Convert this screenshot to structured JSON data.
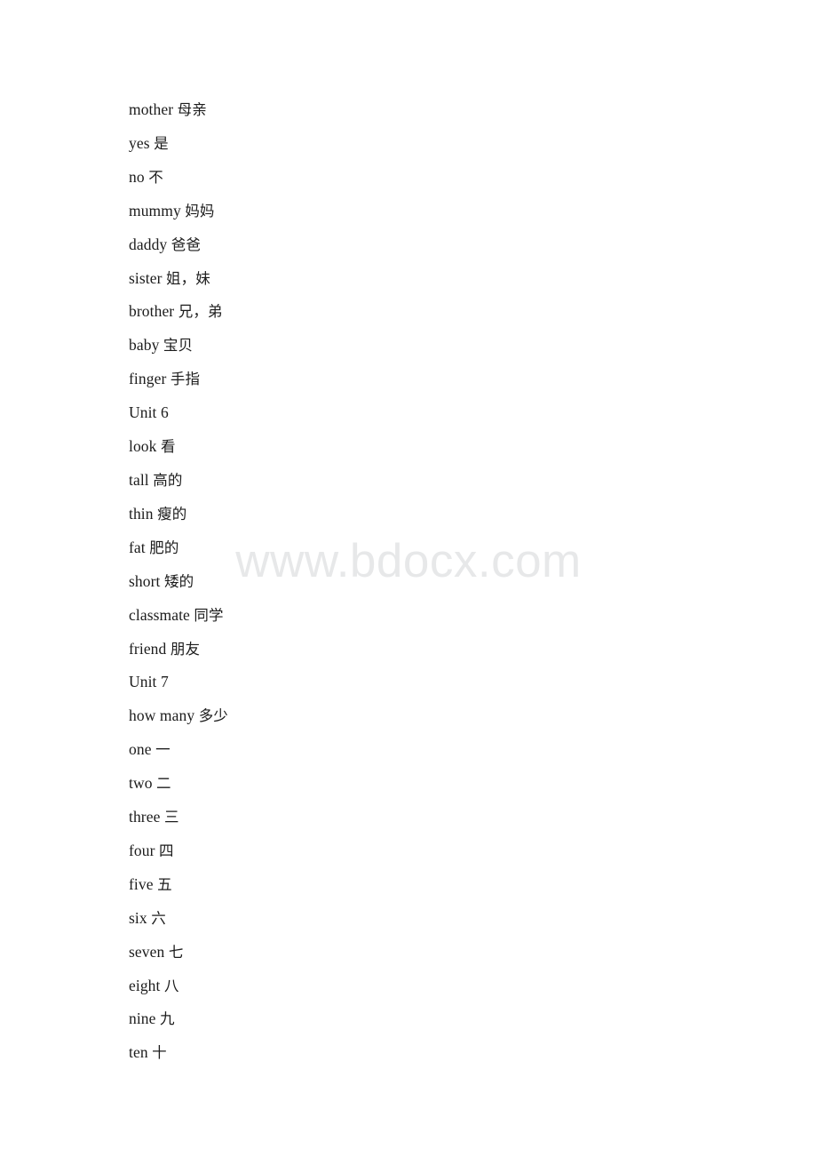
{
  "document": {
    "watermark": "www.bdocx.com",
    "text_color": "#1c1c1c",
    "watermark_color": "#e7e8e9",
    "background_color": "#ffffff"
  },
  "lines": [
    {
      "id": "mother",
      "en": "mother",
      "cn": "母亲",
      "text": "mother 母亲"
    },
    {
      "id": "yes",
      "en": "yes",
      "cn": "是",
      "text": "yes 是"
    },
    {
      "id": "no",
      "en": "no",
      "cn": "不",
      "text": "no 不"
    },
    {
      "id": "mummy",
      "en": "mummy",
      "cn": "妈妈",
      "text": "mummy 妈妈"
    },
    {
      "id": "daddy",
      "en": "daddy",
      "cn": "爸爸",
      "text": "daddy 爸爸"
    },
    {
      "id": "sister",
      "en": "sister",
      "cn": "姐，妹",
      "text": "sister 姐，妹"
    },
    {
      "id": "brother",
      "en": "brother",
      "cn": "兄，弟",
      "text": "brother 兄，弟"
    },
    {
      "id": "baby",
      "en": "baby",
      "cn": "宝贝",
      "text": "baby 宝贝"
    },
    {
      "id": "finger",
      "en": "finger",
      "cn": "手指",
      "text": "finger 手指"
    },
    {
      "id": "unit-6",
      "en": "Unit 6",
      "cn": "",
      "text": "Unit 6"
    },
    {
      "id": "look",
      "en": "look",
      "cn": "看",
      "text": "look 看"
    },
    {
      "id": "tall",
      "en": "tall",
      "cn": "高的",
      "text": "tall 高的"
    },
    {
      "id": "thin",
      "en": "thin",
      "cn": "瘦的",
      "text": "thin 瘦的"
    },
    {
      "id": "fat",
      "en": "fat",
      "cn": "肥的",
      "text": "fat 肥的"
    },
    {
      "id": "short",
      "en": "short",
      "cn": "矮的",
      "text": "short 矮的"
    },
    {
      "id": "classmate",
      "en": "classmate",
      "cn": "同学",
      "text": "classmate 同学"
    },
    {
      "id": "friend",
      "en": "friend",
      "cn": "朋友",
      "text": "friend 朋友"
    },
    {
      "id": "unit-7",
      "en": "Unit 7",
      "cn": "",
      "text": "Unit 7"
    },
    {
      "id": "how-many",
      "en": "how many",
      "cn": "多少",
      "text": "how many 多少"
    },
    {
      "id": "one",
      "en": "one",
      "cn": "一",
      "text": "one 一"
    },
    {
      "id": "two",
      "en": "two",
      "cn": "二",
      "text": "two 二"
    },
    {
      "id": "three",
      "en": "three",
      "cn": "三",
      "text": "three 三"
    },
    {
      "id": "four",
      "en": "four",
      "cn": "四",
      "text": "four 四"
    },
    {
      "id": "five",
      "en": "five",
      "cn": "五",
      "text": "five 五"
    },
    {
      "id": "six",
      "en": "six",
      "cn": "六",
      "text": "six 六"
    },
    {
      "id": "seven",
      "en": "seven",
      "cn": "七",
      "text": "seven 七"
    },
    {
      "id": "eight",
      "en": "eight",
      "cn": "八",
      "text": "eight 八"
    },
    {
      "id": "nine",
      "en": "nine",
      "cn": "九",
      "text": "nine 九"
    },
    {
      "id": "ten",
      "en": "ten",
      "cn": "十",
      "text": "ten 十"
    }
  ]
}
